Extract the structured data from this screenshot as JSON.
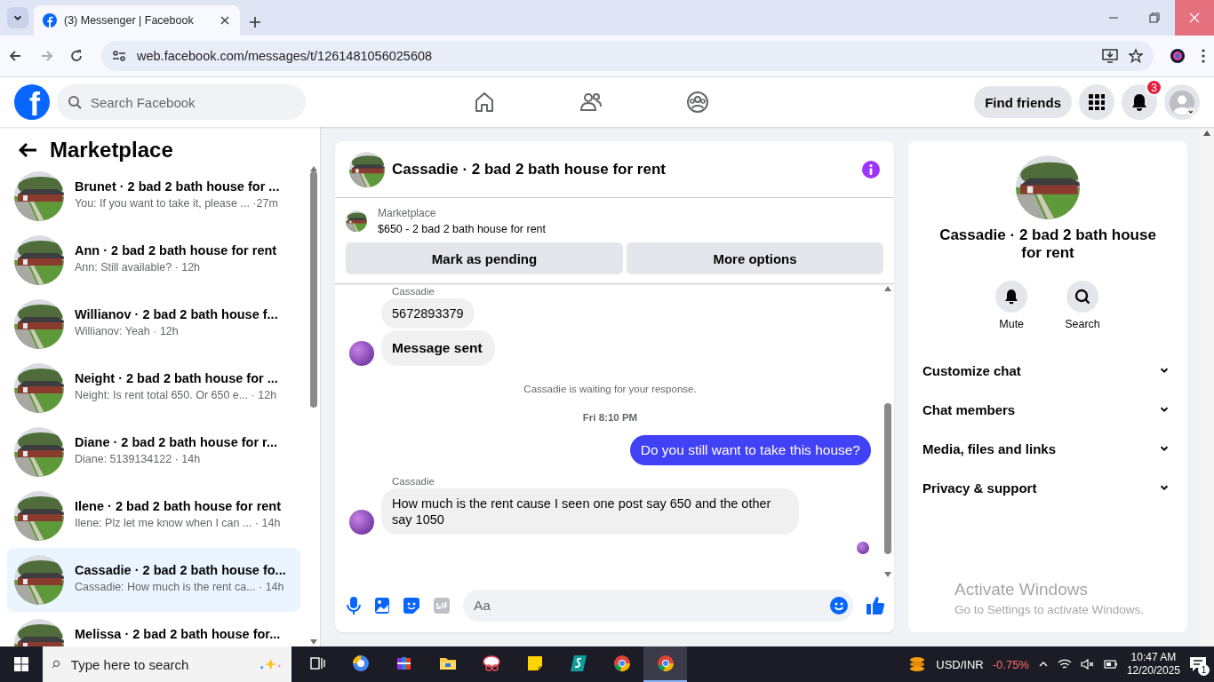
{
  "browser": {
    "tab_title": "(3) Messenger | Facebook",
    "url": "web.facebook.com/messages/t/1261481056025608"
  },
  "header": {
    "logo": "f",
    "search_placeholder": "Search Facebook",
    "find_friends": "Find friends",
    "notification_count": "3"
  },
  "sidebar": {
    "title": "Marketplace",
    "conversations": [
      {
        "title": "Brunet · 2 bad 2 bath house for ...",
        "preview": "You: If you want to take it, please ... ·27m",
        "selected": false
      },
      {
        "title": "Ann · 2 bad 2 bath house for rent",
        "preview": "Ann: Still available? · 12h",
        "selected": false
      },
      {
        "title": "Willianov · 2 bad 2 bath house f...",
        "preview": "Willianov: Yeah · 12h",
        "selected": false
      },
      {
        "title": "Neight · 2 bad 2 bath house for ...",
        "preview": "Neight: Is rent total 650. Or 650 e...  · 12h",
        "selected": false
      },
      {
        "title": "Diane · 2 bad 2 bath house for r...",
        "preview": "Diane: 5139134122 · 14h",
        "selected": false
      },
      {
        "title": "Ilene · 2 bad 2 bath house for rent",
        "preview": "Ilene: Plz let me know when I can ...  · 14h",
        "selected": false
      },
      {
        "title": "Cassadie · 2 bad 2 bath house fo...",
        "preview": "Cassadie: How much is the rent ca... · 14h",
        "selected": true
      },
      {
        "title": "Melissa · 2 bad 2 bath house for...",
        "selected": false
      }
    ]
  },
  "chat": {
    "title": "Cassadie · 2 bad 2 bath house for rent",
    "listing": {
      "label": "Marketplace",
      "text": "$650 - 2 bad 2 bath house for rent",
      "buttons": [
        "Mark as pending",
        "More options"
      ]
    },
    "messages": [
      {
        "kind": "incoming",
        "sender": "Cassadie",
        "bubbles": [
          {
            "text": "5672893379",
            "bold": false
          },
          {
            "text": "Message sent",
            "bold": true
          }
        ]
      },
      {
        "kind": "notice",
        "text": "Cassadie is waiting for your response."
      },
      {
        "kind": "timestamp",
        "text": "Fri 8:10 PM"
      },
      {
        "kind": "outgoing",
        "bubbles": [
          {
            "text": "Do you still want to take this house?",
            "bold": false
          }
        ]
      },
      {
        "kind": "incoming",
        "sender": "Cassadie",
        "bubbles": [
          {
            "text": "How much is the rent cause I seen one post say 650 and the other say 1050",
            "bold": false
          }
        ]
      }
    ],
    "read": true,
    "composer_placeholder": "Aa"
  },
  "details": {
    "title": "Cassadie · 2 bad 2 bath house for rent",
    "actions": [
      {
        "kind": "mute",
        "label": "Mute"
      },
      {
        "kind": "search",
        "label": "Search"
      }
    ],
    "sections": [
      {
        "label": "Customize chat",
        "expanded": false
      },
      {
        "label": "Chat members",
        "expanded": false
      },
      {
        "label": "Media, files and links",
        "expanded": false
      },
      {
        "label": "Privacy & support",
        "expanded": false
      }
    ]
  },
  "activation_notice": {
    "title": "Activate Windows",
    "text": "Go to Settings to activate Windows."
  },
  "taskbar": {
    "search_placeholder": "Type here to search",
    "apps": [
      {
        "kind": "taskview",
        "selected": false
      },
      {
        "kind": "circle",
        "selected": false
      },
      {
        "kind": "books",
        "selected": false
      },
      {
        "kind": "folder",
        "selected": false
      },
      {
        "kind": "snip",
        "selected": false
      },
      {
        "kind": "note",
        "selected": false
      },
      {
        "kind": "s",
        "selected": false
      },
      {
        "kind": "chrome",
        "selected": false
      },
      {
        "kind": "chrome",
        "selected": true
      }
    ],
    "ticker": "USD/INR",
    "change": "-0.75%",
    "time": "10:47 AM",
    "date": "12/20/2025",
    "notifications": "1"
  }
}
